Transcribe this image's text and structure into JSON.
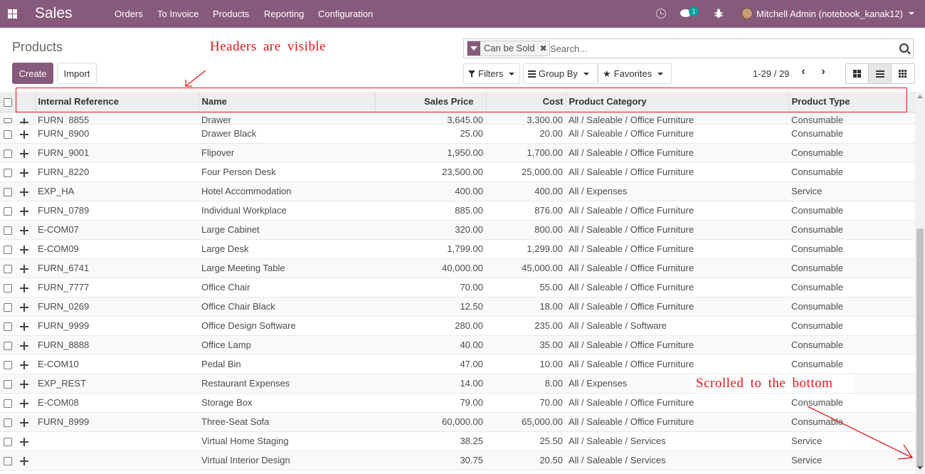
{
  "navbar": {
    "app_name": "Sales",
    "menus": [
      "Orders",
      "To Invoice",
      "Products",
      "Reporting",
      "Configuration"
    ],
    "chat_badge": "1",
    "user": "Mitchell Admin (notebook_kanak12)"
  },
  "control_panel": {
    "breadcrumb": "Products",
    "create_label": "Create",
    "import_label": "Import",
    "facet_label": "Can be Sold",
    "facet_close": "✖",
    "search_placeholder": "Search...",
    "filters_label": "Filters",
    "groupby_label": "Group By",
    "favorites_label": "Favorites",
    "pager": "1-29 / 29",
    "pager_prev": "‹",
    "pager_next": "›"
  },
  "table": {
    "headers": {
      "internal_reference": "Internal Reference",
      "name": "Name",
      "sales_price": "Sales Price",
      "cost": "Cost",
      "product_category": "Product Category",
      "product_type": "Product Type"
    },
    "partial_row": {
      "ref": "FURN_8855",
      "name": "Drawer",
      "price": "3,645.00",
      "cost": "3,300.00",
      "category": "All / Saleable / Office Furniture",
      "type": "Consumable"
    },
    "rows": [
      {
        "ref": "FURN_8900",
        "name": "Drawer Black",
        "price": "25.00",
        "cost": "20.00",
        "category": "All / Saleable / Office Furniture",
        "type": "Consumable"
      },
      {
        "ref": "FURN_9001",
        "name": "Flipover",
        "price": "1,950.00",
        "cost": "1,700.00",
        "category": "All / Saleable / Office Furniture",
        "type": "Consumable"
      },
      {
        "ref": "FURN_8220",
        "name": "Four Person Desk",
        "price": "23,500.00",
        "cost": "25,000.00",
        "category": "All / Saleable / Office Furniture",
        "type": "Consumable"
      },
      {
        "ref": "EXP_HA",
        "name": "Hotel Accommodation",
        "price": "400.00",
        "cost": "400.00",
        "category": "All / Expenses",
        "type": "Service"
      },
      {
        "ref": "FURN_0789",
        "name": "Individual Workplace",
        "price": "885.00",
        "cost": "876.00",
        "category": "All / Saleable / Office Furniture",
        "type": "Consumable"
      },
      {
        "ref": "E-COM07",
        "name": "Large Cabinet",
        "price": "320.00",
        "cost": "800.00",
        "category": "All / Saleable / Office Furniture",
        "type": "Consumable"
      },
      {
        "ref": "E-COM09",
        "name": "Large Desk",
        "price": "1,799.00",
        "cost": "1,299.00",
        "category": "All / Saleable / Office Furniture",
        "type": "Consumable"
      },
      {
        "ref": "FURN_6741",
        "name": "Large Meeting Table",
        "price": "40,000.00",
        "cost": "45,000.00",
        "category": "All / Saleable / Office Furniture",
        "type": "Consumable"
      },
      {
        "ref": "FURN_7777",
        "name": "Office Chair",
        "price": "70.00",
        "cost": "55.00",
        "category": "All / Saleable / Office Furniture",
        "type": "Consumable"
      },
      {
        "ref": "FURN_0269",
        "name": "Office Chair Black",
        "price": "12.50",
        "cost": "18.00",
        "category": "All / Saleable / Office Furniture",
        "type": "Consumable"
      },
      {
        "ref": "FURN_9999",
        "name": "Office Design Software",
        "price": "280.00",
        "cost": "235.00",
        "category": "All / Saleable / Software",
        "type": "Consumable"
      },
      {
        "ref": "FURN_8888",
        "name": "Office Lamp",
        "price": "40.00",
        "cost": "35.00",
        "category": "All / Saleable / Office Furniture",
        "type": "Consumable"
      },
      {
        "ref": "E-COM10",
        "name": "Pedal Bin",
        "price": "47.00",
        "cost": "10.00",
        "category": "All / Saleable / Office Furniture",
        "type": "Consumable"
      },
      {
        "ref": "EXP_REST",
        "name": "Restaurant Expenses",
        "price": "14.00",
        "cost": "8.00",
        "category": "All / Expenses",
        "type": "Service"
      },
      {
        "ref": "E-COM08",
        "name": "Storage Box",
        "price": "79.00",
        "cost": "70.00",
        "category": "All / Saleable / Office Furniture",
        "type": "Consumable"
      },
      {
        "ref": "FURN_8999",
        "name": "Three-Seat Sofa",
        "price": "60,000.00",
        "cost": "65,000.00",
        "category": "All / Saleable / Office Furniture",
        "type": "Consumable"
      },
      {
        "ref": "",
        "name": "Virtual Home Staging",
        "price": "38.25",
        "cost": "25.50",
        "category": "All / Saleable / Services",
        "type": "Service"
      },
      {
        "ref": "",
        "name": "Virtual Interior Design",
        "price": "30.75",
        "cost": "20.50",
        "category": "All / Saleable / Services",
        "type": "Service"
      }
    ]
  },
  "annotations": {
    "headers_note": "Headers are visible",
    "scroll_note": "Scrolled to the bottom",
    "color": "#e8141b"
  },
  "colors": {
    "brand": "#875a7b",
    "badge": "#00a09d"
  }
}
